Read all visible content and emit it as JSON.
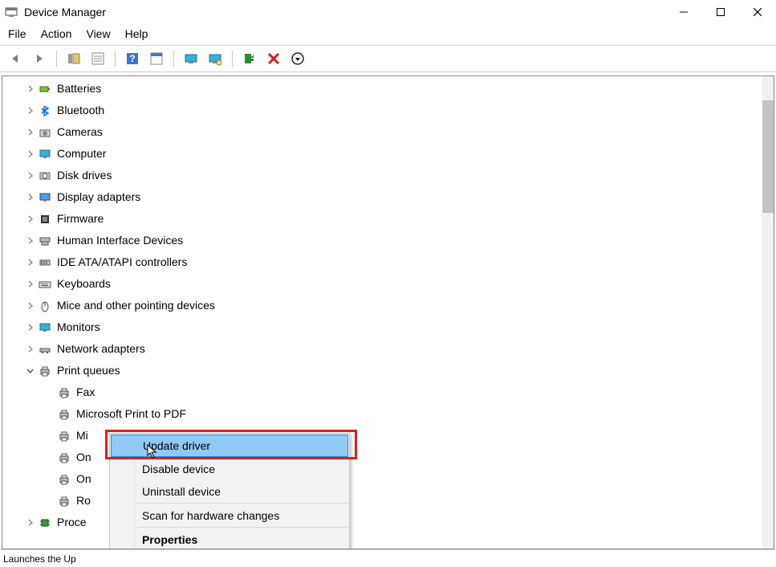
{
  "window_title": "Device Manager",
  "menu": {
    "file": "File",
    "action": "Action",
    "view": "View",
    "help": "Help"
  },
  "toolbar_icons": {
    "back": "back-arrow-icon",
    "forward": "forward-arrow-icon",
    "show_hide": "show-hide-console-tree-icon",
    "help_btn": "help-icon",
    "action_btn": "action-icon",
    "monitor1": "view-icon",
    "monitor2": "scan-hardware-icon",
    "add_legacy": "add-legacy-hardware-icon",
    "delete_btn": "uninstall-icon",
    "down_btn": "update-driver-icon"
  },
  "tree": {
    "items": [
      {
        "label": "Batteries",
        "icon": "battery",
        "expand": ">"
      },
      {
        "label": "Bluetooth",
        "icon": "bluetooth",
        "expand": ">"
      },
      {
        "label": "Cameras",
        "icon": "camera",
        "expand": ">"
      },
      {
        "label": "Computer",
        "icon": "monitor",
        "expand": ">"
      },
      {
        "label": "Disk drives",
        "icon": "disk",
        "expand": ">"
      },
      {
        "label": "Display adapters",
        "icon": "display",
        "expand": ">"
      },
      {
        "label": "Firmware",
        "icon": "firmware",
        "expand": ">"
      },
      {
        "label": "Human Interface Devices",
        "icon": "hid",
        "expand": ">"
      },
      {
        "label": "IDE ATA/ATAPI controllers",
        "icon": "ide",
        "expand": ">"
      },
      {
        "label": "Keyboards",
        "icon": "keyboard",
        "expand": ">"
      },
      {
        "label": "Mice and other pointing devices",
        "icon": "mouse",
        "expand": ">"
      },
      {
        "label": "Monitors",
        "icon": "monitor",
        "expand": ">"
      },
      {
        "label": "Network adapters",
        "icon": "network",
        "expand": ">"
      },
      {
        "label": "Print queues",
        "icon": "printer",
        "expand": "v"
      },
      {
        "label": "Fax",
        "icon": "printer",
        "child": true
      },
      {
        "label": "Microsoft Print to PDF",
        "icon": "printer",
        "child": true
      },
      {
        "label": "Mi",
        "icon": "printer",
        "child": true,
        "cut": true
      },
      {
        "label": "On",
        "icon": "printer",
        "child": true,
        "cut": true
      },
      {
        "label": "On",
        "icon": "printer",
        "child": true,
        "cut": true
      },
      {
        "label": "Ro",
        "icon": "printer",
        "child": true,
        "cut": true
      },
      {
        "label": "Proce",
        "icon": "processor",
        "expand": ">",
        "cut": true
      }
    ]
  },
  "context_menu": {
    "update": "Update driver",
    "disable": "Disable device",
    "uninstall": "Uninstall device",
    "scan": "Scan for hardware changes",
    "properties": "Properties"
  },
  "statusbar_text": "Launches the Up",
  "highlight_color": "#e31b1b"
}
